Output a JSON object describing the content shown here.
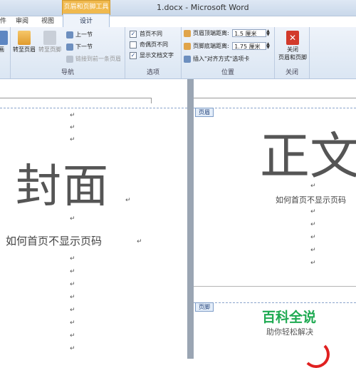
{
  "window": {
    "title": "1.docx - Microsoft Word"
  },
  "tabs": {
    "left_partial": "件",
    "review": "审阅",
    "view": "视图",
    "context_group": "页眉和页脚工具",
    "design": "设计"
  },
  "ribbon": {
    "nav_group": {
      "label": "导航",
      "goto_header": "转至页眉",
      "goto_footer": "转至页脚",
      "prev_section": "上一节",
      "next_section": "下一节",
      "link_previous": "链接到前一条页眉"
    },
    "options_group": {
      "label": "选项",
      "first_page_diff": "首页不同",
      "odd_even_diff": "奇偶页不同",
      "show_doc_text": "显示文档文字",
      "first_page_checked": "✓",
      "show_doc_checked": "✓"
    },
    "position_group": {
      "label": "位置",
      "header_top_label": "页眉顶端距离:",
      "header_top_value": "1.5 厘米",
      "footer_bottom_label": "页脚底端距离:",
      "footer_bottom_value": "1.75 厘米",
      "insert_align_tab": "插入\"对齐方式\"选项卡"
    },
    "close_group": {
      "label": "关闭",
      "close_button_line1": "关闭",
      "close_button_line2": "页眉和页脚"
    },
    "left_partial_btn": "画"
  },
  "document": {
    "left_page": {
      "cover_text": "封面",
      "subtitle": "如何首页不显示页码"
    },
    "right_page": {
      "header_tag": "页眉",
      "footer_tag": "页脚",
      "body_big": "正文",
      "subtitle": "如何首页不显示页码"
    },
    "paragraph_mark": "↵"
  },
  "watermark": {
    "line1": "百科全说",
    "line2": "助你轻松解决"
  }
}
